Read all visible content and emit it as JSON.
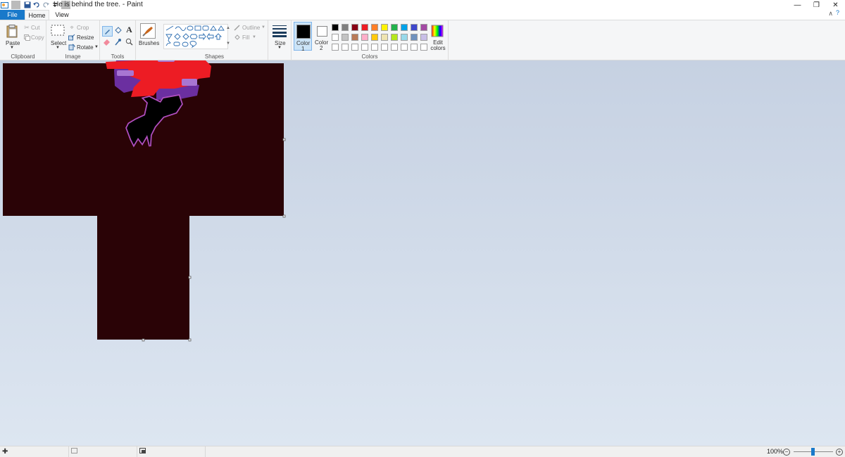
{
  "window": {
    "title": "He is behind the tree. - Paint",
    "qat_icons": [
      "paint-app-icon",
      "save-icon",
      "undo-icon",
      "redo-icon",
      "customize-qat-icon"
    ],
    "controls": {
      "minimize": "—",
      "restore": "❐",
      "close": "✕"
    }
  },
  "tabs": {
    "file": "File",
    "home": "Home",
    "view": "View",
    "collapse": "∧",
    "help": "?"
  },
  "ribbon": {
    "clipboard": {
      "group_label": "Clipboard",
      "paste": "Paste",
      "cut": "Cut",
      "copy": "Copy"
    },
    "image": {
      "group_label": "Image",
      "select": "Select",
      "crop": "Crop",
      "resize": "Resize",
      "rotate": "Rotate"
    },
    "tools": {
      "group_label": "Tools",
      "brushes": "Brushes"
    },
    "shapes": {
      "group_label": "Shapes",
      "outline": "Outline",
      "fill": "Fill"
    },
    "size": {
      "label": "Size"
    },
    "colors": {
      "group_label": "Colors",
      "color1_label": "Color",
      "color1_num": "1",
      "color2_label": "Color",
      "color2_num": "2",
      "color1_value": "#000000",
      "color2_value": "#ffffff",
      "edit_colors": "Edit colors",
      "palette_row1": [
        "#000000",
        "#7f7f7f",
        "#880015",
        "#ed1c24",
        "#ff7f27",
        "#fff200",
        "#22b14c",
        "#00a2e8",
        "#3f48cc",
        "#a349a4"
      ],
      "palette_row2": [
        "#ffffff",
        "#c3c3c3",
        "#b97a57",
        "#ffaec9",
        "#ffc90e",
        "#efe4b0",
        "#b5e61d",
        "#99d9ea",
        "#7092be",
        "#c8bfe7"
      ],
      "palette_row3": [
        "#ffffff",
        "#ffffff",
        "#ffffff",
        "#ffffff",
        "#ffffff",
        "#ffffff",
        "#ffffff",
        "#ffffff",
        "#ffffff",
        "#ffffff"
      ]
    }
  },
  "canvas": {
    "background_color": "#2a0306",
    "tree_leaves_color": "#ed1c24",
    "tree_purple_color": "#6b2fa0",
    "creature_color": "#000000",
    "creature_outline_color": "#b04fc0"
  },
  "status": {
    "zoom": "100%",
    "zoom_out": "−",
    "zoom_in": "+"
  }
}
